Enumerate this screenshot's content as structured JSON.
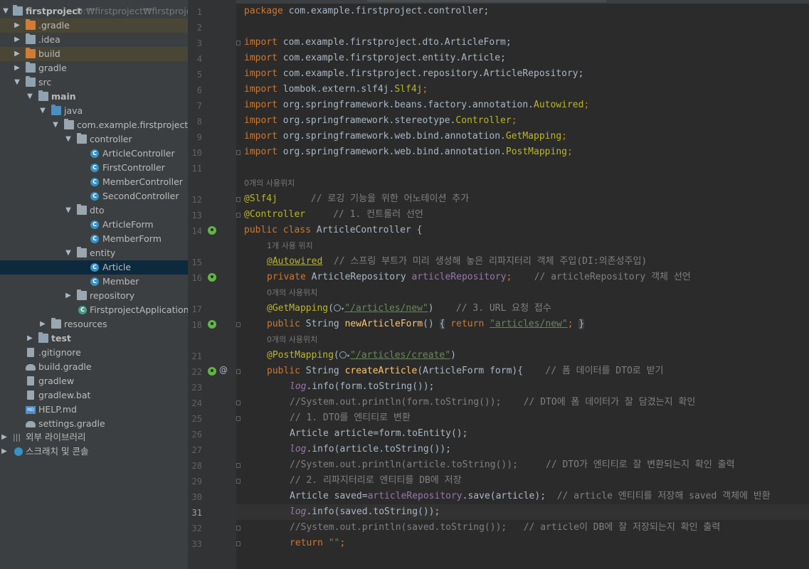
{
  "project_tree": {
    "root": {
      "name": "firstproject",
      "path": "D:₩firstproject₩firstproject"
    },
    "items": [
      {
        "label": ".gradle"
      },
      {
        "label": ".idea"
      },
      {
        "label": "build"
      },
      {
        "label": "gradle"
      },
      {
        "label": "src"
      },
      {
        "label": "main"
      },
      {
        "label": "java"
      },
      {
        "label": "com.example.firstproject"
      },
      {
        "label": "controller"
      },
      {
        "label": "ArticleController"
      },
      {
        "label": "FirstController"
      },
      {
        "label": "MemberController"
      },
      {
        "label": "SecondController"
      },
      {
        "label": "dto"
      },
      {
        "label": "ArticleForm"
      },
      {
        "label": "MemberForm"
      },
      {
        "label": "entity"
      },
      {
        "label": "Article"
      },
      {
        "label": "Member"
      },
      {
        "label": "repository"
      },
      {
        "label": "FirstprojectApplication"
      },
      {
        "label": "resources"
      },
      {
        "label": "test"
      },
      {
        "label": ".gitignore"
      },
      {
        "label": "build.gradle"
      },
      {
        "label": "gradlew"
      },
      {
        "label": "gradlew.bat"
      },
      {
        "label": "HELP.md"
      },
      {
        "label": "settings.gradle"
      },
      {
        "label": "외부 라이브러리"
      },
      {
        "label": "스크래치 및 콘솔"
      }
    ]
  },
  "editor": {
    "current_line": "31",
    "line_numbers": [
      "1",
      "2",
      "3",
      "4",
      "5",
      "6",
      "7",
      "8",
      "9",
      "10",
      "11",
      "12",
      "13",
      "14",
      "15",
      "16",
      "17",
      "18",
      "21",
      "22",
      "23",
      "24",
      "25",
      "26",
      "27",
      "28",
      "29",
      "30",
      "31",
      "32",
      "33"
    ],
    "hints": [
      "0개의 사용위치",
      "1개 사용 위치",
      "0개의 사용위치",
      "0개의 사용위치"
    ],
    "gutter_at": "@",
    "code": {
      "pkg_kw": "package",
      "pkg_name": " com.example.firstproject.controller;",
      "imp_kw": "import",
      "imp3": " com.example.firstproject.dto.ArticleForm;",
      "imp4": " com.example.firstproject.entity.Article;",
      "imp5": " com.example.firstproject.repository.ArticleRepository;",
      "imp6a": " lombok.extern.slf4j.",
      "imp6b": "Slf4j",
      "semi": ";",
      "imp7a": " org.springframework.beans.factory.annotation.",
      "imp7b": "Autowired",
      "imp8a": " org.springframework.stereotype.",
      "imp8b": "Controller",
      "imp9a": " org.springframework.web.bind.annotation.",
      "imp9b": "GetMapping",
      "imp10a": " org.springframework.web.bind.annotation.",
      "imp10b": "PostMapping",
      "l12a": "@Slf4j",
      "l12b": "      // 로깅 기능을 위한 어노테이션 추가",
      "l13a": "@Controller",
      "l13b": "     // 1. 컨트롤러 선언",
      "l14kw": "public class",
      "l14b": " ArticleController {",
      "l15a": "@Autowired",
      "l15b": "  // 스프링 부트가 미리 생성해 놓은 리파지터리 객체 주입(DI:의존성주입)",
      "l16kw": "private",
      "l16b": " ArticleRepository ",
      "l16c": "articleRepository",
      "l16d": ";",
      "l16e": "    // articleRepository 객체 선언",
      "l17a": "@GetMapping",
      "paren_open": "(",
      "l17str": "\"/articles/new\"",
      "paren_close": ")",
      "l17cmt": "    // 3. URL 요청 접수",
      "l18kw": "public",
      "l18b": " String ",
      "l18fn": "newArticleForm",
      "l18c": "() ",
      "l18d": "{",
      "l18e": " return ",
      "l18f": "\"articles/new\"",
      "l18g": "; ",
      "l18h": "}",
      "l21a": "@PostMapping",
      "l21str": "\"/articles/create\"",
      "l22kw": "public",
      "l22b": " String ",
      "l22fn": "createArticle",
      "l22c": "(ArticleForm form){",
      "l22d": "    // 폼 데이터를 DTO로 받기",
      "log": "log",
      "l23": ".info(form.toString());",
      "l24a": "//System.out.println(form.toString());",
      "l24b": "    // DTO에 폼 데이터가 잘 담겼는지 확인",
      "l25": "// 1. DTO를 엔티티로 변환",
      "l26": "Article article=form.toEntity();",
      "l27": ".info(article.toString());",
      "l28a": "//System.out.println(article.toString());",
      "l28b": "     // DTO가 엔티티로 잘 변환되는지 확인 출력",
      "l29": "// 2. 리파지터리로 엔티티를 DB에 저장",
      "l30a": "Article saved=",
      "l30b": "articleRepository",
      "l30c": ".save(article);",
      "l30d": "  // article 엔티티를 저장해 saved 객체에 반환",
      "l31": ".info(saved.toString());",
      "l32a": "//System.out.println(saved.toString());",
      "l32b": "   // article이 DB에 잘 저장되는지 확인 출력",
      "l33kw": "return",
      "l33b": " \"\"",
      "l33c": ";"
    }
  },
  "colors": {
    "keyword": "#cc7832",
    "annotation": "#bbb529",
    "string": "#6a8759",
    "comment": "#808080",
    "field": "#9876aa",
    "method": "#ffc66d",
    "folder": "#8fa2b0",
    "excluded_folder": "#d17b36",
    "class_icon": "#3592c4"
  }
}
